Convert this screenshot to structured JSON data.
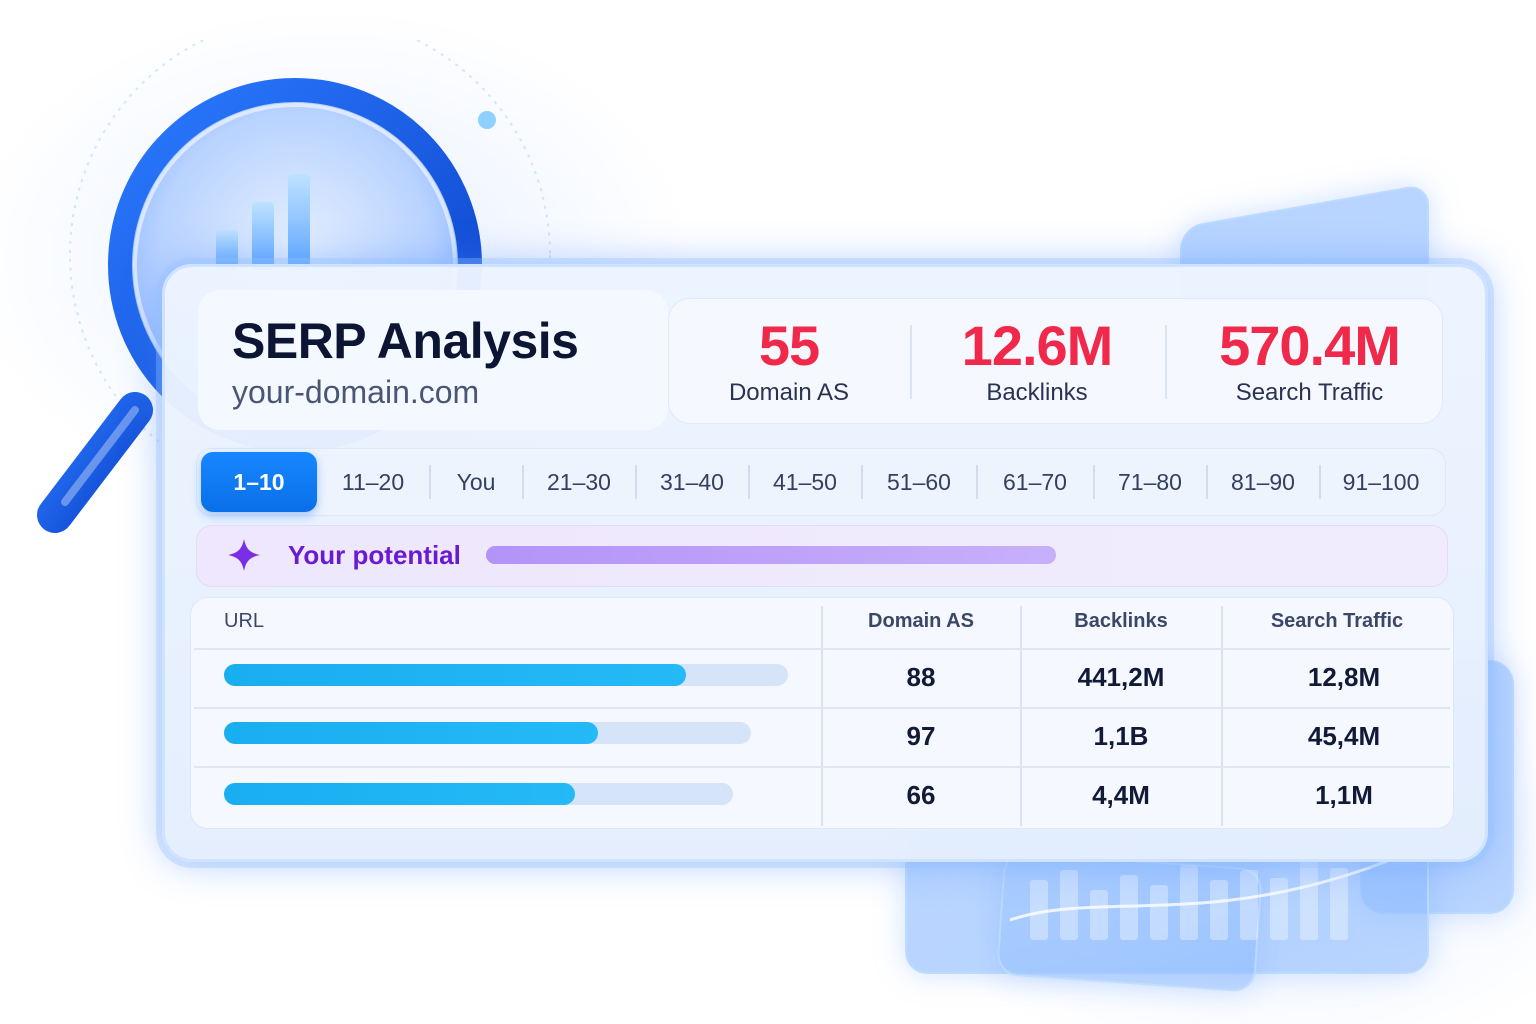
{
  "header": {
    "title": "SERP Analysis",
    "domain": "your-domain.com"
  },
  "stats": [
    {
      "value": "55",
      "label": "Domain AS"
    },
    {
      "value": "12.6M",
      "label": "Backlinks"
    },
    {
      "value": "570.4M",
      "label": "Search Traffic"
    }
  ],
  "tabs": [
    "1–10",
    "11–20",
    "You",
    "21–30",
    "31–40",
    "41–50",
    "51–60",
    "61–70",
    "71–80",
    "81–90",
    "91–100"
  ],
  "active_tab": "1–10",
  "potential": {
    "label": "Your potential",
    "icon": "sparkle-icon",
    "progress": 1.0
  },
  "table": {
    "headers": [
      "URL",
      "Domain AS",
      "Backlinks",
      "Search Traffic"
    ],
    "rows": [
      {
        "url_bar": 0.82,
        "domain_as": "88",
        "backlinks": "441,2M",
        "traffic": "12,8M"
      },
      {
        "url_bar": 0.71,
        "domain_as": "97",
        "backlinks": "1,1B",
        "traffic": "45,4M"
      },
      {
        "url_bar": 0.69,
        "domain_as": "66",
        "backlinks": "4,4M",
        "traffic": "1,1M"
      }
    ]
  },
  "colors": {
    "stat_value": "#f0284a",
    "active_tab": "#1787ff",
    "potential_text": "#6a19d4",
    "bar": "#18aef0"
  },
  "decor": {
    "magnifier": "magnifier-chart-icon"
  }
}
